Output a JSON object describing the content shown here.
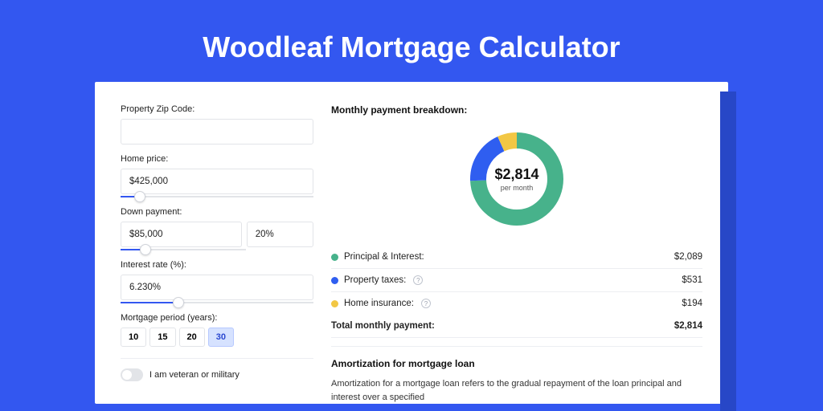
{
  "page_title": "Woodleaf Mortgage Calculator",
  "form": {
    "zip_label": "Property Zip Code:",
    "zip_value": "",
    "home_price_label": "Home price:",
    "home_price_value": "$425,000",
    "home_price_slider_pct": 10,
    "down_payment_label": "Down payment:",
    "down_payment_value": "$85,000",
    "down_payment_pct_value": "20%",
    "down_payment_slider_pct": 20,
    "interest_rate_label": "Interest rate (%):",
    "interest_rate_value": "6.230%",
    "interest_rate_slider_pct": 30,
    "mortgage_period_label": "Mortgage period (years):",
    "periods": [
      "10",
      "15",
      "20",
      "30"
    ],
    "period_selected": "30",
    "veteran_label": "I am veteran or military",
    "veteran_on": false
  },
  "breakdown": {
    "title": "Monthly payment breakdown:",
    "center_amount": "$2,814",
    "center_sub": "per month",
    "items": [
      {
        "label": "Principal & Interest:",
        "value": "$2,089",
        "color": "#47b28b",
        "help": false
      },
      {
        "label": "Property taxes:",
        "value": "$531",
        "color": "#2f5ef0",
        "help": true
      },
      {
        "label": "Home insurance:",
        "value": "$194",
        "color": "#f2c744",
        "help": true
      }
    ],
    "total_label": "Total monthly payment:",
    "total_value": "$2,814"
  },
  "chart_data": {
    "type": "pie",
    "title": "Monthly payment breakdown",
    "series": [
      {
        "name": "Principal & Interest",
        "value": 2089,
        "color": "#47b28b"
      },
      {
        "name": "Property taxes",
        "value": 531,
        "color": "#2f5ef0"
      },
      {
        "name": "Home insurance",
        "value": 194,
        "color": "#f2c744"
      }
    ],
    "total": 2814
  },
  "amortization": {
    "title": "Amortization for mortgage loan",
    "text": "Amortization for a mortgage loan refers to the gradual repayment of the loan principal and interest over a specified"
  }
}
